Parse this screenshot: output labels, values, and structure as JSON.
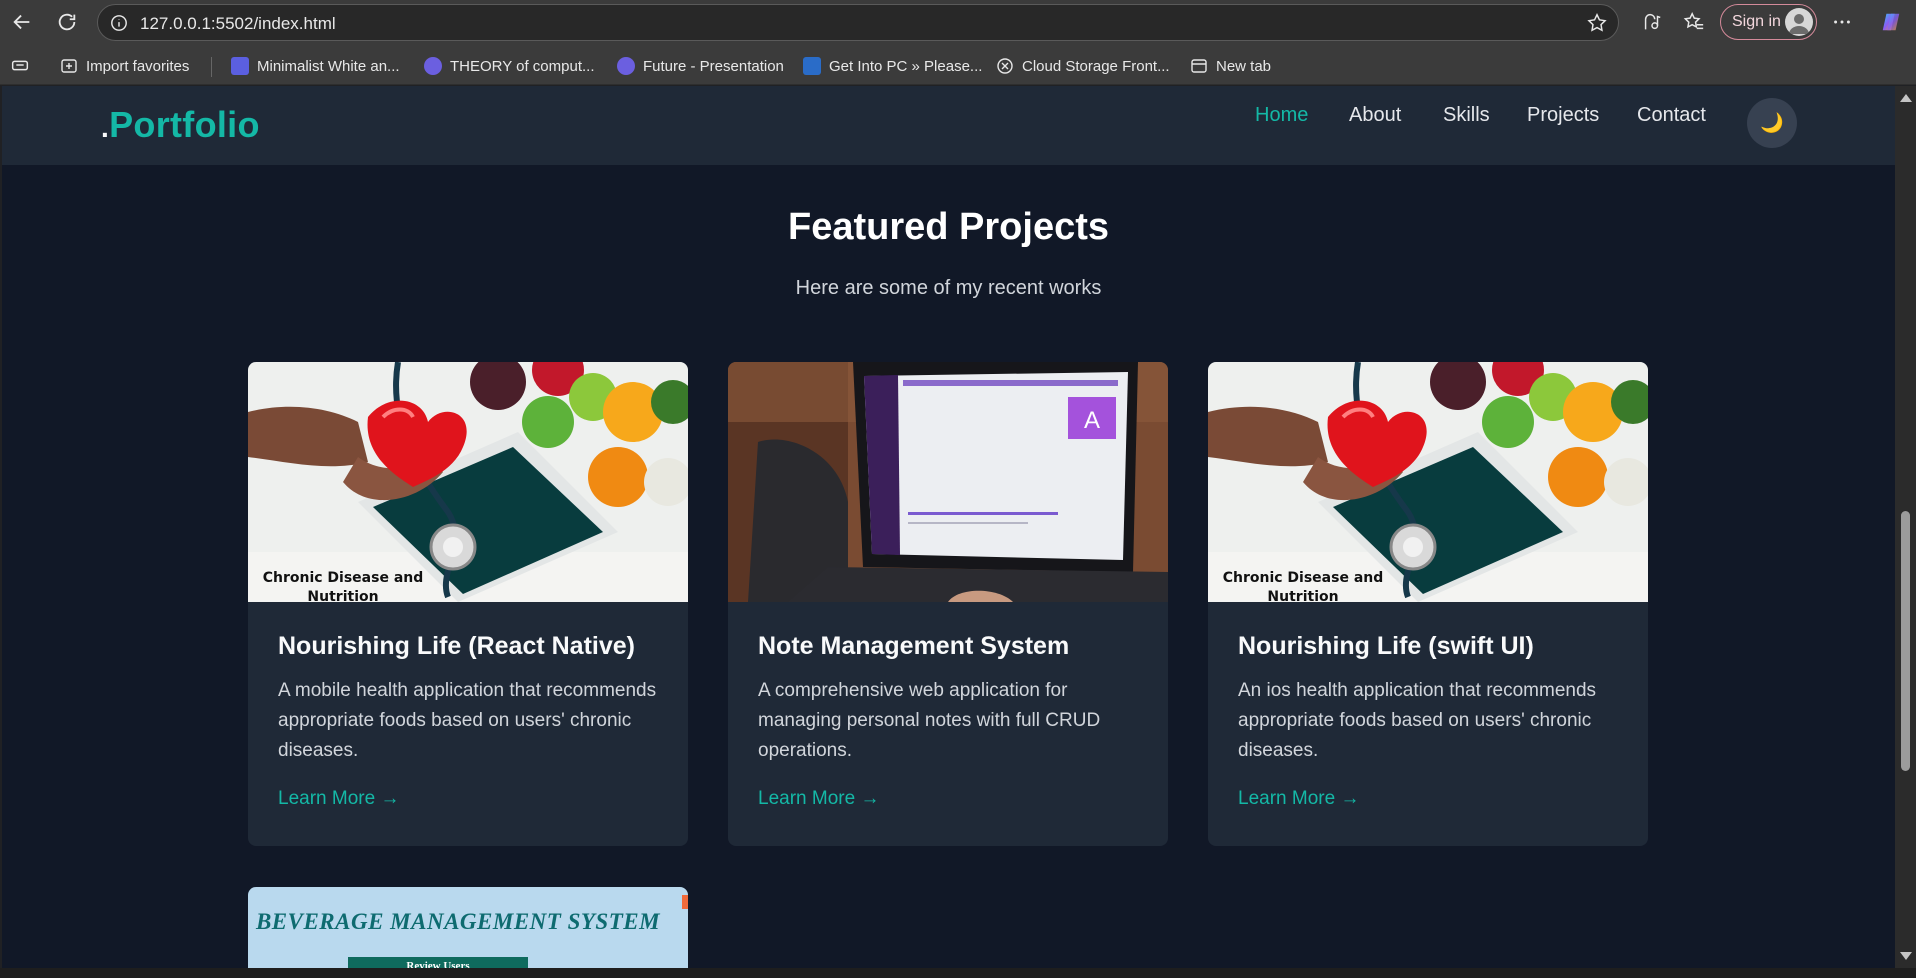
{
  "browser": {
    "url": "127.0.0.1:5502/index.html",
    "signin_label": "Sign in",
    "bookmarks": [
      {
        "label": "Import favorites",
        "icon": "import-icon"
      },
      {
        "label": "Minimalist White an...",
        "icon": "presentation-icon"
      },
      {
        "label": "THEORY of comput...",
        "icon": "presentation-icon"
      },
      {
        "label": "Future - Presentation",
        "icon": "presentation-icon"
      },
      {
        "label": "Get Into PC » Please...",
        "icon": "getintopc-icon"
      },
      {
        "label": "Cloud Storage Front...",
        "icon": "openai-icon"
      },
      {
        "label": "New tab",
        "icon": "newtab-icon"
      }
    ]
  },
  "site": {
    "logo_dot": ".",
    "logo_text": "Portfolio",
    "nav": [
      "Home",
      "About",
      "Skills",
      "Projects",
      "Contact"
    ],
    "active_nav": "Home",
    "theme_toggle_icon": "moon-icon"
  },
  "projects_section": {
    "title": "Featured Projects",
    "subtitle": "Here are some of my recent works",
    "cards": [
      {
        "title": "Nourishing Life (React Native)",
        "description": "A mobile health application that recommends appropriate foods based on users' chronic diseases.",
        "link": "Learn More →",
        "image_caption_line1": "Chronic Disease and",
        "image_caption_line2": "Nutrition"
      },
      {
        "title": "Note Management System",
        "description": "A comprehensive web application for managing personal notes with full CRUD operations.",
        "link": "Learn More →",
        "image_avatar_letter": "A"
      },
      {
        "title": "Nourishing Life (swift UI)",
        "description": "An ios health application that recommends appropriate foods based on users' chronic diseases.",
        "link": "Learn More →",
        "image_caption_line1": "Chronic Disease and",
        "image_caption_line2": "Nutrition"
      },
      {
        "image_title": "BEVERAGE MANAGEMENT SYSTEM",
        "image_button": "Review Users"
      }
    ]
  },
  "colors": {
    "accent": "#14b8a6",
    "page_bg": "#111827",
    "card_bg": "#1f2937"
  }
}
